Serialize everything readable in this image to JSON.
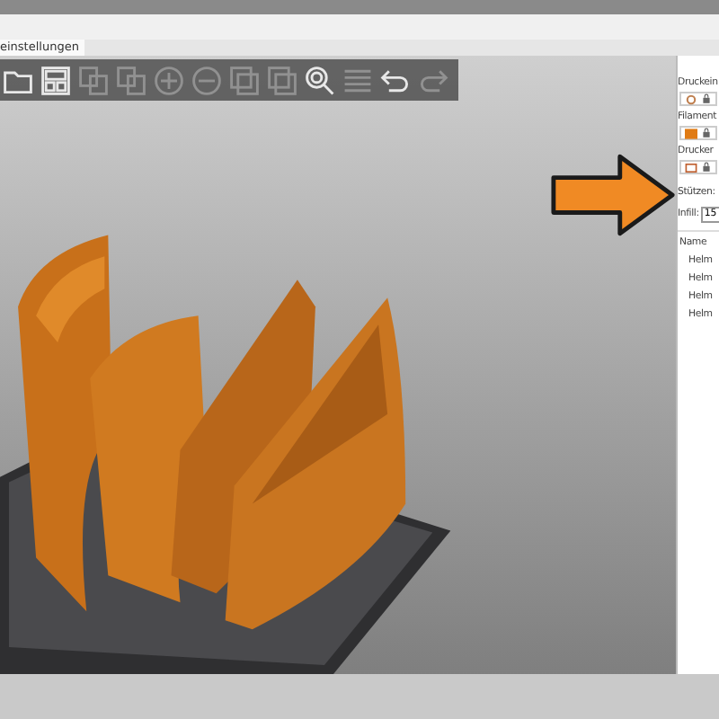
{
  "tab": {
    "label": "einstellungen",
    "selected": true
  },
  "toolbar": [
    {
      "kind": "folder",
      "disabled": false
    },
    {
      "kind": "layout",
      "disabled": false
    },
    {
      "kind": "copy",
      "disabled": true
    },
    {
      "kind": "paste",
      "disabled": true
    },
    {
      "kind": "plus",
      "disabled": true
    },
    {
      "kind": "minus",
      "disabled": true
    },
    {
      "kind": "instance",
      "disabled": true
    },
    {
      "kind": "instance",
      "disabled": true
    },
    {
      "kind": "search",
      "disabled": false
    },
    {
      "kind": "layers",
      "disabled": true
    },
    {
      "kind": "undo",
      "disabled": false
    },
    {
      "kind": "redo",
      "disabled": true
    }
  ],
  "sidebar": {
    "sections": [
      {
        "label": "Druckein",
        "kind": "gear"
      },
      {
        "label": "Filament",
        "kind": "swatch"
      },
      {
        "label": "Drucker",
        "kind": "printer"
      }
    ],
    "supports_label": "Stützen:",
    "infill_label": "Infill:",
    "infill_value": "15",
    "list_header": "Name",
    "objects": [
      "Helm",
      "Helm",
      "Helm",
      "Helm"
    ]
  }
}
